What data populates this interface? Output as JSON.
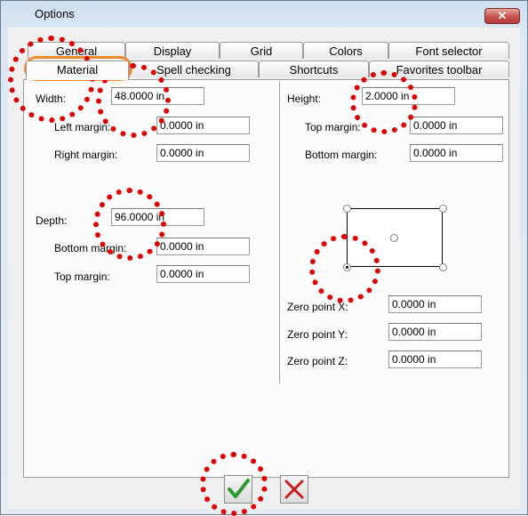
{
  "window": {
    "title": "Options",
    "close_glyph": "✕"
  },
  "tabs_row1": [
    "General",
    "Display",
    "Grid",
    "Colors",
    "Font selector"
  ],
  "tabs_row2": [
    "Material",
    "Spell checking",
    "Shortcuts",
    "Favorites toolbar"
  ],
  "active_tab": "Material",
  "fields": {
    "width": {
      "label": "Width:",
      "value": "48.0000 in"
    },
    "left_margin": {
      "label": "Left margin:",
      "value": "0.0000 in"
    },
    "right_margin": {
      "label": "Right margin:",
      "value": "0.0000 in"
    },
    "depth": {
      "label": "Depth:",
      "value": "96.0000 in"
    },
    "bottom_margin_left": {
      "label": "Bottom margin:",
      "value": "0.0000 in"
    },
    "top_margin_left": {
      "label": "Top margin:",
      "value": "0.0000 in"
    },
    "height": {
      "label": "Height:",
      "value": "2.0000 in"
    },
    "top_margin_right": {
      "label": "Top margin:",
      "value": "0.0000 in"
    },
    "bottom_margin_right": {
      "label": "Bottom margin:",
      "value": "0.0000 in"
    },
    "zero_x": {
      "label": "Zero point X:",
      "value": "0.0000 in"
    },
    "zero_y": {
      "label": "Zero point Y:",
      "value": "0.0000 in"
    },
    "zero_z": {
      "label": "Zero point Z:",
      "value": "0.0000 in"
    }
  },
  "zero_point_selected": "bottom-left",
  "buttons": {
    "ok_icon": "check-icon",
    "cancel_icon": "x-icon"
  },
  "colors": {
    "annotation_red": "#e00000",
    "highlight_orange": "#f08a2c",
    "ok_green": "#2e9a2e",
    "cancel_red": "#c81e1e"
  }
}
